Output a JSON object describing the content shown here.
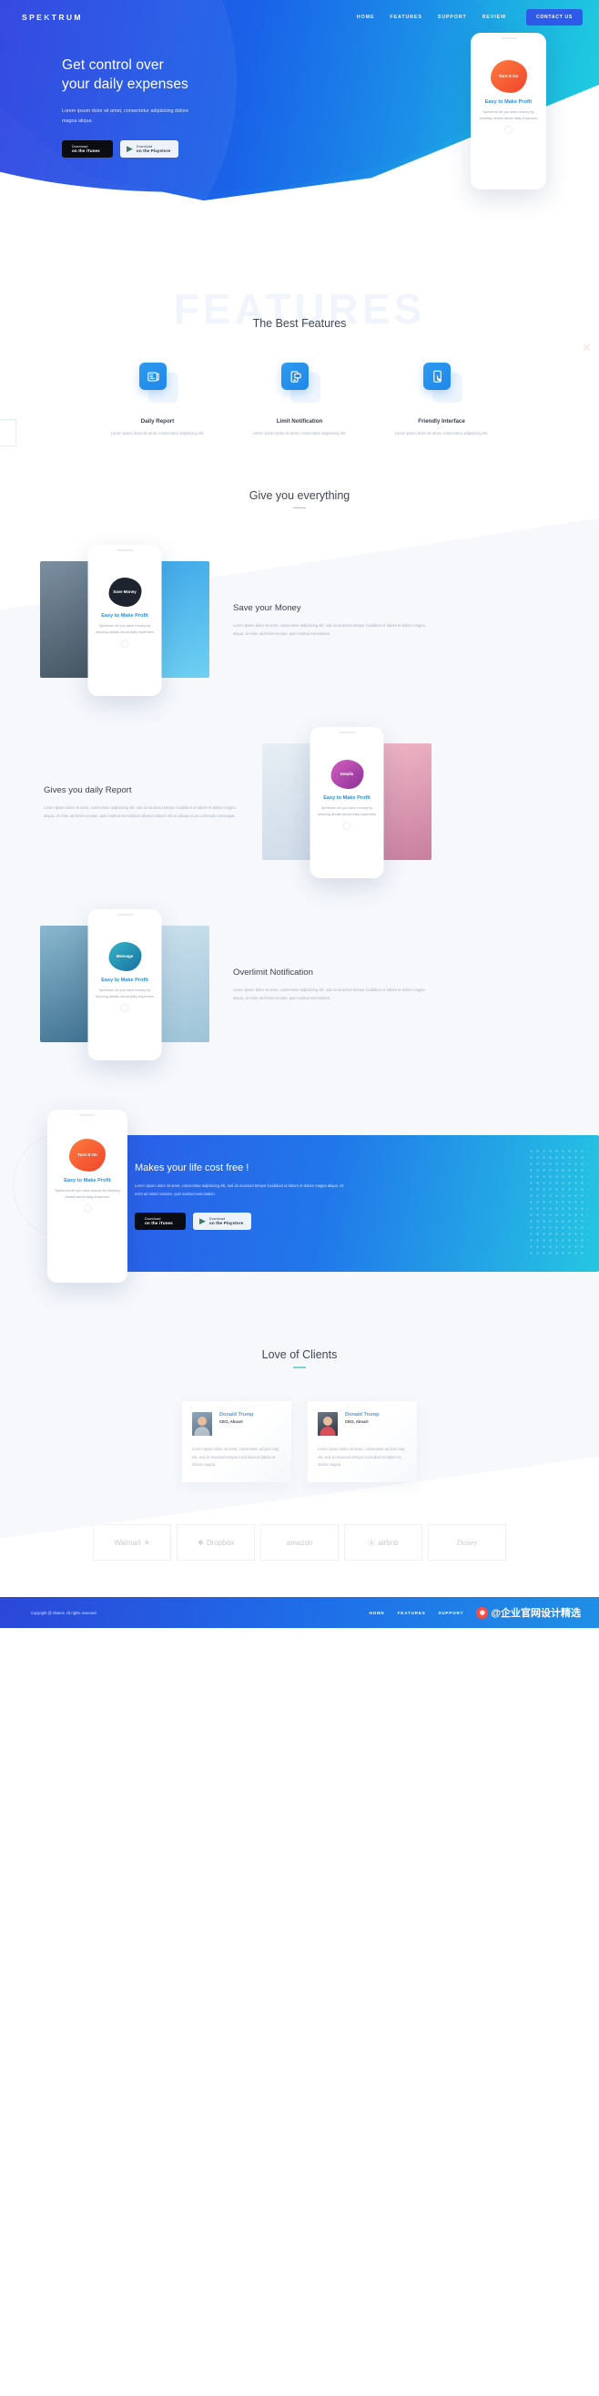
{
  "brand": {
    "name_part1": "SPE",
    "name_part2": "K",
    "name_part3": "TRUM"
  },
  "nav": {
    "items": [
      {
        "label": "HOME"
      },
      {
        "label": "FEATURES"
      },
      {
        "label": "SUPPORT"
      },
      {
        "label": "REVIEW"
      }
    ],
    "cta": "CONTACT US"
  },
  "hero": {
    "title_line1": "Get control over",
    "title_line2": "your daily expenses",
    "subtitle": "Lorem ipsum dolor sit amet, consectetur adipisicing dolore magna aliqua.",
    "store_buttons": [
      {
        "icon": "apple-icon",
        "glyph": "",
        "top": "Download",
        "bottom": "on the iTunes"
      },
      {
        "icon": "play-store-icon",
        "glyph": "▶",
        "top": "Download",
        "bottom": "on the Playstore"
      }
    ],
    "phone": {
      "blob_label": "Turn It On",
      "title": "Easy to Make Profit",
      "body": "Spektrum let you save money by keeping details about daily expences"
    }
  },
  "features": {
    "watermark": "FEATURES",
    "title": "The Best Features",
    "items": [
      {
        "icon": "newspaper-report-icon",
        "glyph": "▤",
        "title": "Daily Report",
        "body": "Lorem ipsum dolor sit amet, consectetur adipisicing elit,"
      },
      {
        "icon": "notification-phone-icon",
        "glyph": "✉",
        "title": "Limit Notification",
        "body": "Lorem ipsum dolor sit amet, consectetur adipisicing elit,"
      },
      {
        "icon": "touch-phone-icon",
        "glyph": "☝",
        "title": "Friendly Interface",
        "body": "Lorem ipsum dolor sit amet, consectetur adipisicing elit,"
      }
    ]
  },
  "everything": {
    "title": "Give you everything",
    "rows": [
      {
        "heading": "Save your Money",
        "body": "Lorem ipsum dolor sit amet, consectetur adipisicing elit, sed do eiusmod tempor incididunt ut labore et dolore magna aliqua. Ut enim ad minim veniam, quis nostrud exercitation.",
        "phone": {
          "blob_label": "Save Money",
          "title": "Easy to Make Profit",
          "body": "Spektrum let you save money by keeping details about daily expences"
        },
        "blob_color": "#1d2430",
        "layout": "text-right"
      },
      {
        "heading": "Gives you daily Report",
        "body": "Lorem ipsum dolor sit amet, consectetur adipisicing elit, sed do eiusmod tempor incididunt ut labore et dolore magna aliqua. Ut enim ad minim veniam, quis nostrud exercitation ullamco laboris nisi ut aliquip ex ea commodo consequat.",
        "phone": {
          "blob_label": "Details",
          "title": "Easy to Make Profit",
          "body": "Spektrum let you save money by keeping details about daily expences"
        },
        "blob_color": "#c0399b",
        "layout": "text-left"
      },
      {
        "heading": "Overlimit Notification",
        "body": "Lorem ipsum dolor sit amet, consectetur adipisicing elit, sed do eiusmod tempor incididunt ut labore et dolore magna aliqua. Ut enim ad minim veniam, quis nostrud exercitation.",
        "phone": {
          "blob_label": "Message",
          "title": "Easy to Make Profit",
          "body": "Spektrum let you save money by keeping details about daily expences"
        },
        "blob_color": "#1f8fae",
        "layout": "text-right"
      }
    ]
  },
  "cta": {
    "title": "Makes your life cost free !",
    "body": "Lorem ipsum dolor sit amet, consectetur adipisicing elit, sed do eiusmod tempor incididunt ut labore et dolore magna aliqua. Ut enim ad minim veniam, quis nostrud exercitation.",
    "store_buttons": [
      {
        "icon": "apple-icon",
        "glyph": "",
        "top": "Download",
        "bottom": "on the iTunes"
      },
      {
        "icon": "play-store-icon",
        "glyph": "▶",
        "top": "Download",
        "bottom": "on the Playstore"
      }
    ],
    "phone": {
      "blob_label": "Turn It On",
      "title": "Easy to Make Profit",
      "body": "Spektrum let you save money by keeping details about daily expences"
    }
  },
  "clients": {
    "title": "Love of Clients",
    "testimonials": [
      {
        "name": "Donald Trump",
        "role": "CEO, Almart",
        "body": "Lorem ipsum dolor sit amet, consectetur ad ipisi cing elit, sed do eiusmod tempor incid idunt ut labore et dolore magna."
      },
      {
        "name": "Donald Trump",
        "role": "CEO, Almart",
        "body": "Lorem ipsum dolor sit amet, consectetur ad ipisi cing elit, sed do eiusmod tempor incid idunt ut labore et dolore magna."
      }
    ]
  },
  "logos": [
    {
      "name": "Walmart",
      "mark": "✳"
    },
    {
      "name": "Dropbox",
      "mark": "❖"
    },
    {
      "name": "amazon",
      "mark": ""
    },
    {
      "name": "airbnb",
      "mark": "Ⓐ"
    },
    {
      "name": "Disney",
      "mark": ""
    }
  ],
  "footer": {
    "copyright": "Copyright @ Shams. All rights reserved.",
    "links": [
      {
        "label": "HOME"
      },
      {
        "label": "FEATURES"
      },
      {
        "label": "SUPPORT"
      }
    ],
    "watermark": "@企业官网设计精选"
  },
  "colors": {
    "accent": "#1f86ea",
    "cyan": "#1fd6dd",
    "deep_blue": "#2b3fe0",
    "teal_underline": "#7fd3d8"
  }
}
